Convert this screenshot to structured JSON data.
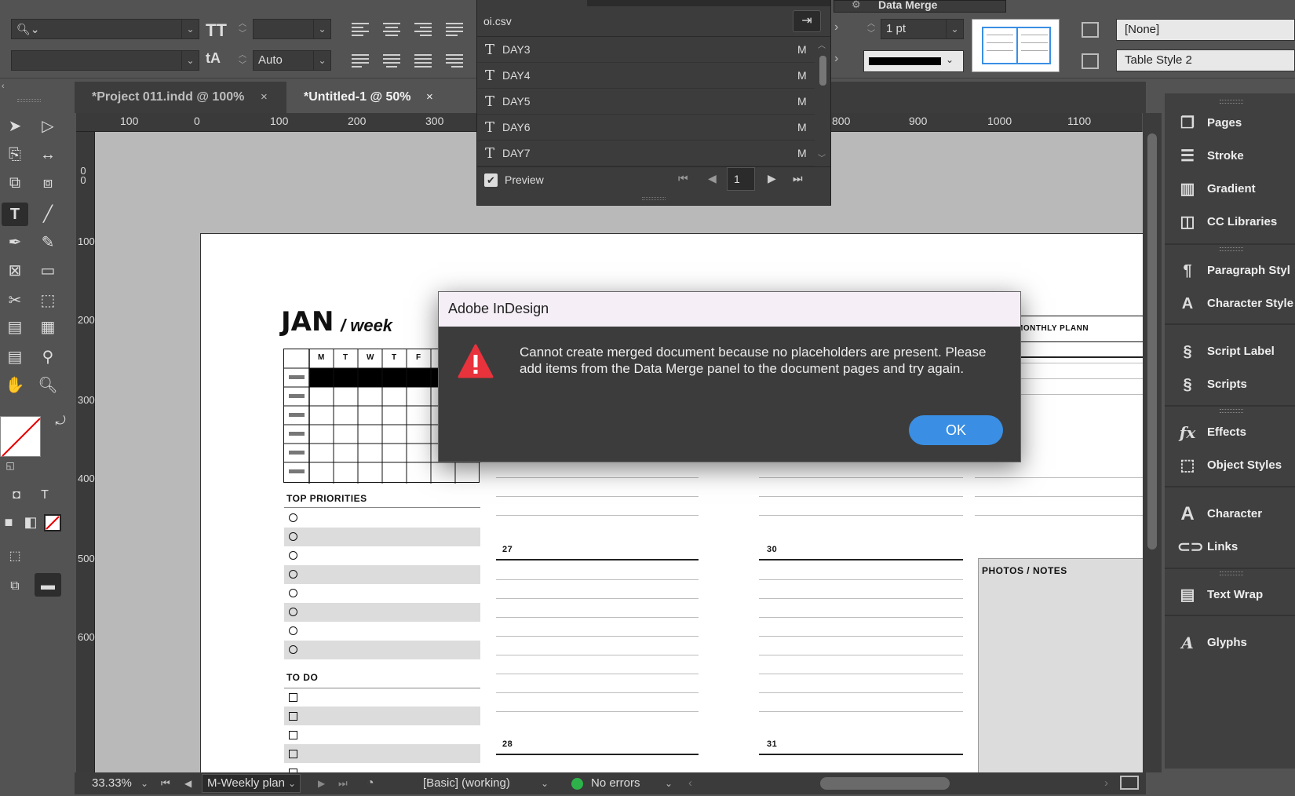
{
  "control_bar": {
    "font_search_placeholder": "",
    "font_style_value": "",
    "font_size_value": "",
    "leading_value": "Auto",
    "stroke_weight": "1 pt",
    "cell_style": "[None]",
    "table_style": "Table Style 2"
  },
  "tabs": [
    {
      "label": "*Project 011.indd @ 100%",
      "close": "×"
    },
    {
      "label": "*Untitled-1 @ 50%",
      "close": "×"
    }
  ],
  "ruler": {
    "h_labels": [
      "100",
      "0",
      "100",
      "200",
      "300",
      "800",
      "900",
      "1000",
      "1100"
    ],
    "v_labels": [
      "0",
      "0",
      "100",
      "200",
      "300",
      "400",
      "500",
      "600"
    ]
  },
  "data_merge": {
    "panel_title": "Data Merge",
    "source_file": "oi.csv",
    "fields": [
      {
        "name": "DAY3",
        "type": "M"
      },
      {
        "name": "DAY4",
        "type": "M"
      },
      {
        "name": "DAY5",
        "type": "M"
      },
      {
        "name": "DAY6",
        "type": "M"
      },
      {
        "name": "DAY7",
        "type": "M"
      }
    ],
    "preview_label": "Preview",
    "record_number": "1"
  },
  "document": {
    "month": "JAN",
    "week_label": "/ week",
    "weekday_headers": [
      "M",
      "T",
      "W",
      "T",
      "F"
    ],
    "monthly_plan_button": "MONTHLY PLANN",
    "top_priorities": "TOP PRIORITIES",
    "to_do": "TO DO",
    "photos_notes": "PHOTOS / NOTES",
    "day_numbers": [
      "27",
      "30",
      "28",
      "31"
    ]
  },
  "dialog": {
    "title": "Adobe InDesign",
    "message": "Cannot create merged document because no placeholders are present. Please add items from the Data Merge panel to the document pages and try again.",
    "ok_label": "OK",
    "icon": "warning-icon",
    "icon_color": "#e8323c"
  },
  "panels": [
    {
      "label": "Pages",
      "icon": "pages-icon"
    },
    {
      "label": "Stroke",
      "icon": "stroke-icon"
    },
    {
      "label": "Gradient",
      "icon": "gradient-icon"
    },
    {
      "label": "CC Libraries",
      "icon": "cc-libraries-icon"
    },
    {
      "label": "Paragraph Styl",
      "icon": "paragraph-styles-icon"
    },
    {
      "label": "Character Style",
      "icon": "character-styles-icon"
    },
    {
      "label": "Script Label",
      "icon": "script-label-icon"
    },
    {
      "label": "Scripts",
      "icon": "scripts-icon"
    },
    {
      "label": "Effects",
      "icon": "effects-icon"
    },
    {
      "label": "Object Styles",
      "icon": "object-styles-icon"
    },
    {
      "label": "Character",
      "icon": "character-icon"
    },
    {
      "label": "Links",
      "icon": "links-icon"
    },
    {
      "label": "Text Wrap",
      "icon": "text-wrap-icon"
    },
    {
      "label": "Glyphs",
      "icon": "glyphs-icon"
    }
  ],
  "status_bar": {
    "zoom": "33.33%",
    "page": "M-Weekly plan",
    "profile": "[Basic] (working)",
    "errors": "No errors",
    "error_status_color": "#2db34a"
  },
  "accent_color": "#3a8fe4"
}
